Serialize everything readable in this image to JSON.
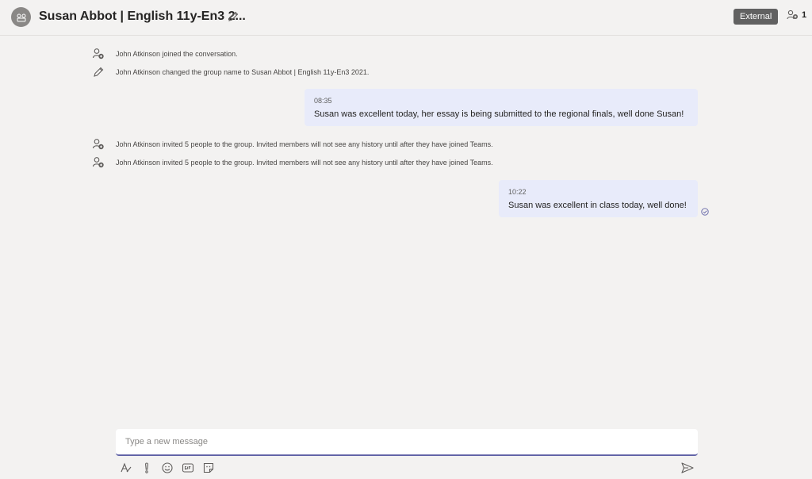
{
  "header": {
    "title": "Susan Abbot | English 11y-En3 2...",
    "external_badge": "External",
    "participant_count": "1"
  },
  "events": [
    {
      "text": "John Atkinson joined the conversation.",
      "icon": "person-add-icon"
    },
    {
      "text": "John Atkinson changed the group name to Susan Abbot | English 11y-En3 2021.",
      "icon": "pencil-icon"
    },
    {
      "text": "John Atkinson invited 5 people to the group. Invited members will not see any history until after they have joined Teams.",
      "icon": "person-add-icon"
    },
    {
      "text": "John Atkinson invited 5 people to the group. Invited members will not see any history until after they have joined Teams.",
      "icon": "person-add-icon"
    }
  ],
  "messages": [
    {
      "time": "08:35",
      "text": "Susan was excellent today, her essay is being submitted to the regional finals, well done Susan!"
    },
    {
      "time": "10:22",
      "text": "Susan was excellent in class today, well done!"
    }
  ],
  "compose": {
    "placeholder": "Type a new message"
  },
  "toolbar": {
    "icons": [
      "format-icon",
      "important-icon",
      "emoji-icon",
      "gif-icon",
      "sticker-icon"
    ],
    "send_icon": "send-icon"
  },
  "colors": {
    "background": "#f3f2f1",
    "bubble": "#e8ebfa",
    "accent": "#6264a7",
    "badge": "#616161"
  }
}
